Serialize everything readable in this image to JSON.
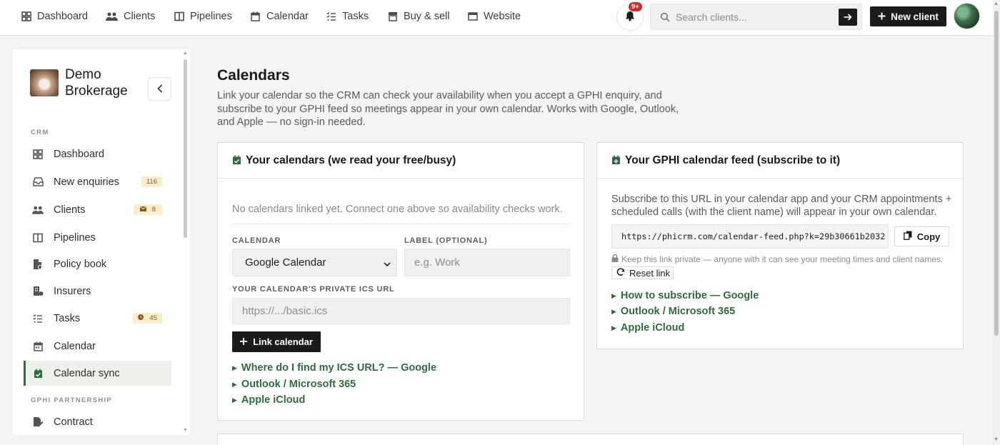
{
  "nav": {
    "items": [
      {
        "label": "Dashboard",
        "icon": "dashboard-icon"
      },
      {
        "label": "Clients",
        "icon": "users-icon"
      },
      {
        "label": "Pipelines",
        "icon": "columns-icon"
      },
      {
        "label": "Calendar",
        "icon": "calendar-icon"
      },
      {
        "label": "Tasks",
        "icon": "tasks-icon"
      },
      {
        "label": "Buy & sell",
        "icon": "storefront-icon"
      },
      {
        "label": "Website",
        "icon": "window-icon"
      }
    ],
    "notifications_badge": "9+",
    "search_placeholder": "Search clients...",
    "new_client_label": "New client"
  },
  "sidebar": {
    "brand_name": "Demo Brokerage",
    "sections": {
      "crm": "CRM",
      "gphi": "GPHI PARTNERSHIP"
    },
    "items": [
      {
        "label": "Dashboard",
        "icon": "dashboard-icon"
      },
      {
        "label": "New enquiries",
        "icon": "inbox-icon",
        "badge": "116"
      },
      {
        "label": "Clients",
        "icon": "users-icon",
        "badge": "8",
        "badge_icon": "envelope-icon"
      },
      {
        "label": "Pipelines",
        "icon": "columns-icon"
      },
      {
        "label": "Policy book",
        "icon": "file-icon"
      },
      {
        "label": "Insurers",
        "icon": "building-icon"
      },
      {
        "label": "Tasks",
        "icon": "tasks-icon",
        "badge": "45",
        "badge_icon": "clock-icon"
      },
      {
        "label": "Calendar",
        "icon": "calendar-icon"
      },
      {
        "label": "Calendar sync",
        "icon": "calendar-check-icon",
        "active": true
      },
      {
        "label": "Contract",
        "icon": "file-signature-icon"
      }
    ]
  },
  "main": {
    "title": "Calendars",
    "description": "Link your calendar so the CRM can check your availability when you accept a GPHI enquiry, and subscribe to your GPHI feed so meetings appear in your own calendar. Works with Google, Outlook, and Apple — no sign-in needed.",
    "your_calendars": {
      "heading": "Your calendars (we read your free/busy)",
      "empty_text": "No calendars linked yet. Connect one above so availability checks work.",
      "calendar_label": "CALENDAR",
      "calendar_value": "Google Calendar",
      "label_label": "LABEL (OPTIONAL)",
      "label_placeholder": "e.g. Work",
      "ics_label": "YOUR CALENDAR'S PRIVATE ICS URL",
      "ics_placeholder": "https://.../basic.ics",
      "link_button": "Link calendar",
      "help_links": [
        "Where do I find my ICS URL? — Google",
        "Outlook / Microsoft 365",
        "Apple iCloud"
      ]
    },
    "feed": {
      "heading": "Your GPHI calendar feed (subscribe to it)",
      "description": "Subscribe to this URL in your calendar app and your CRM appointments + scheduled calls (with the client name) will appear in your own calendar.",
      "url": "https://phicrm.com/calendar-feed.php?k=29b30661b2032",
      "copy_label": "Copy",
      "private_note": "Keep this link private — anyone with it can see your meeting times and client names.",
      "reset_label": "Reset link",
      "help_links": [
        "How to subscribe — Google",
        "Outlook / Microsoft 365",
        "Apple iCloud"
      ]
    }
  },
  "colors": {
    "accent_green": "#2f6b3f",
    "dark_button": "#1b1b1b",
    "badge_bg": "#fbecd0",
    "notify_red": "#c9302c"
  }
}
